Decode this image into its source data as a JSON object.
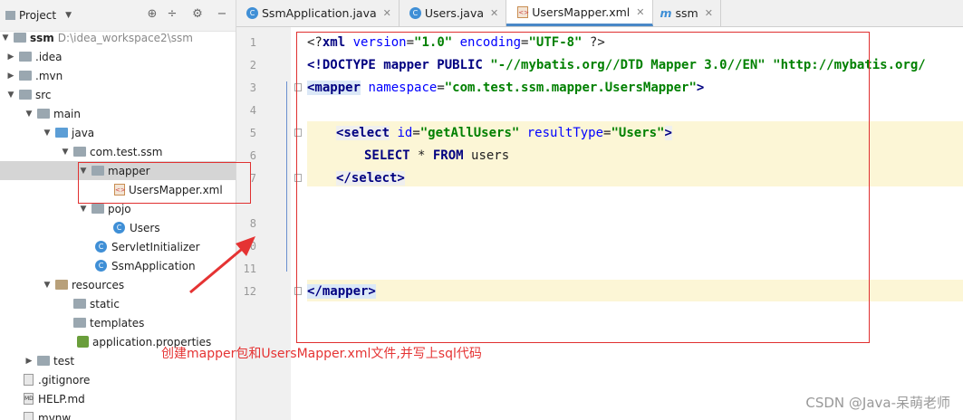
{
  "project_panel": {
    "title": "Project",
    "root": {
      "name": "ssm",
      "path": "D:\\idea_workspace2\\ssm"
    },
    "tree": {
      "idea": ".idea",
      "mvn": ".mvn",
      "src": "src",
      "main": "main",
      "java": "java",
      "pkg": "com.test.ssm",
      "mapper": "mapper",
      "mapper_xml": "UsersMapper.xml",
      "pojo": "pojo",
      "users": "Users",
      "servlet_init": "ServletInitializer",
      "ssm_app": "SsmApplication",
      "resources": "resources",
      "static": "static",
      "templates": "templates",
      "app_props": "application.properties",
      "test": "test",
      "gitignore": ".gitignore",
      "help": "HELP.md",
      "mvnw": "mvnw"
    }
  },
  "tabs": [
    "SsmApplication.java",
    "Users.java",
    "UsersMapper.xml",
    "ssm"
  ],
  "editor": {
    "line_numbers": [
      "1",
      "2",
      "3",
      "4",
      "5",
      "6",
      "7",
      "8",
      "9",
      "10",
      "11",
      "12"
    ],
    "l1_open": "<?",
    "l1_kw": "xml",
    "l1_a1": " version",
    "l1_v1": "\"1.0\"",
    "l1_a2": " encoding",
    "l1_v2": "\"UTF-8\"",
    "l1_close": " ?>",
    "l2_kw": "<!DOCTYPE mapper PUBLIC ",
    "l2_v1": "\"-//mybatis.org//DTD Mapper 3.0//EN\"",
    "l2_v2": " \"http://mybatis.org/",
    "l3_tag": "<mapper",
    "l3_attr": " namespace",
    "l3_val": "\"com.test.ssm.mapper.UsersMapper\"",
    "l3_end": ">",
    "l5_tag": "<select",
    "l5_a1": " id",
    "l5_v1": "\"getAllUsers\"",
    "l5_a2": " resultType",
    "l5_v2": "\"Users\"",
    "l5_end": ">",
    "l6_sql_kw1": "SELECT",
    "l6_sql_mid": " * ",
    "l6_sql_kw2": "FROM",
    "l6_sql_tbl": " users",
    "l7_close": "</select>",
    "l12_close": "</mapper>"
  },
  "annotation": "创建mapper包和UsersMapper.xml文件,并写上sql代码",
  "watermark": "CSDN @Java-呆萌老师",
  "colors": {
    "highlight_box": "#e03030",
    "annotation": "#e53333",
    "caret_row": "#fcf6d6"
  }
}
